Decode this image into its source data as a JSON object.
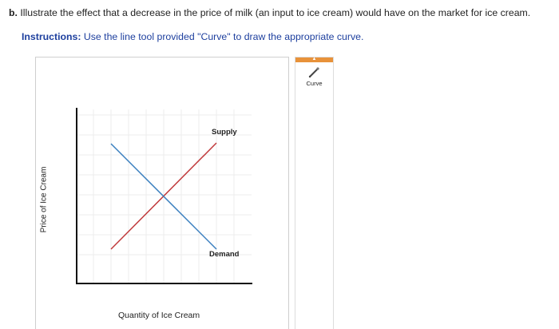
{
  "question": {
    "label": "b.",
    "text": "Illustrate the effect that a decrease in the price of milk (an input to ice cream) would have on the market for ice cream."
  },
  "instructions": {
    "label": "Instructions:",
    "text": "Use the line tool provided \"Curve\" to draw the appropriate curve."
  },
  "graph": {
    "y_axis_label": "Price of Ice Cream",
    "x_axis_label": "Quantity of Ice Cream",
    "supply_label": "Supply",
    "demand_label": "Demand",
    "supply_color": "#c0393b",
    "demand_color": "#3a7fbf",
    "grid_color": "#ececec"
  },
  "tools": {
    "header_color": "#e8923a",
    "collapse_icon": "up-arrow-icon",
    "curve": {
      "label": "Curve",
      "icon": "pencil-icon"
    }
  }
}
